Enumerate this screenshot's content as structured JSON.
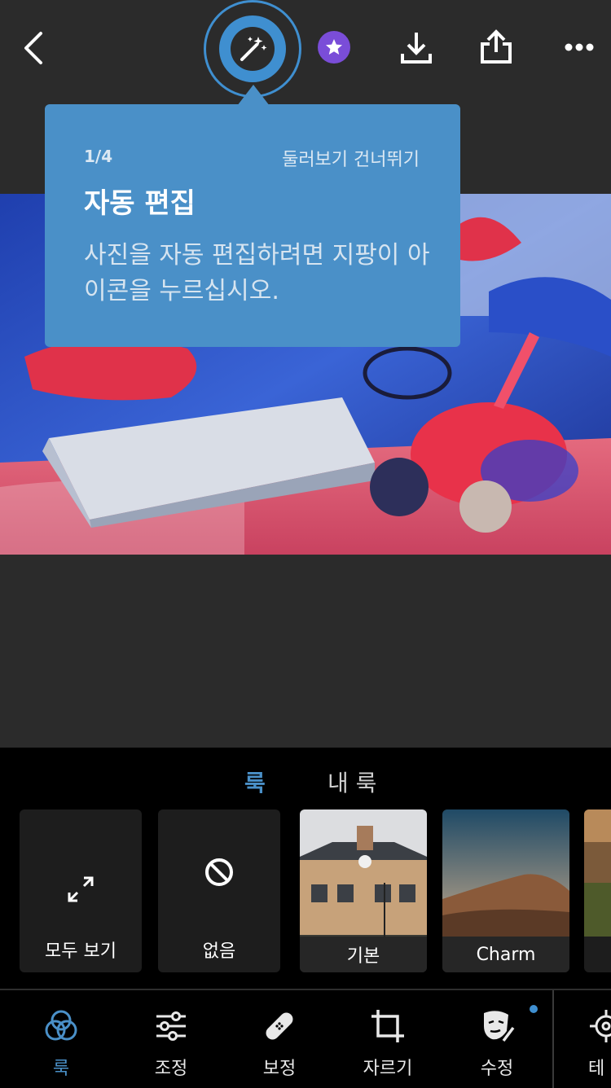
{
  "toolbar": {
    "back": "back-icon",
    "auto_edit": "magic-wand-icon",
    "premium": "star-badge-icon",
    "download": "download-icon",
    "share": "share-icon",
    "more": "more-icon"
  },
  "tooltip": {
    "step": "1/4",
    "skip": "둘러보기 건너뛰기",
    "title": "자동 편집",
    "body": "사진을 자동 편집하려면 지팡이 아이콘을 누르십시오."
  },
  "looks": {
    "tabs": [
      "룩",
      "내 룩"
    ],
    "presets": [
      "모두 보기",
      "없음",
      "기본",
      "Charm"
    ]
  },
  "bottom_nav": {
    "items": [
      "룩",
      "조정",
      "보정",
      "자르기",
      "수정",
      "테"
    ]
  },
  "colors": {
    "accent": "#4a90c8",
    "tooltip_bg": "#4a90c8",
    "badge": "#7a4dd8"
  }
}
